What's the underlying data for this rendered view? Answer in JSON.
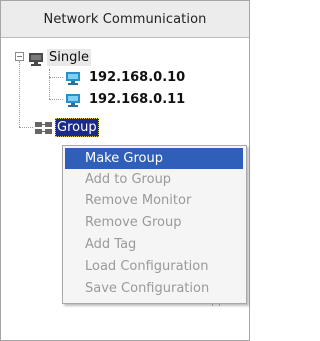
{
  "panel": {
    "header": "Network Communication"
  },
  "tree": {
    "root": {
      "label": "Single",
      "expanded": "−",
      "children": [
        {
          "label": "192.168.0.10",
          "icon": "monitor-icon"
        },
        {
          "label": "192.168.0.11",
          "icon": "monitor-icon"
        }
      ]
    },
    "group": {
      "label": "Group",
      "icon": "group-network-icon"
    }
  },
  "context_menu": {
    "items": [
      {
        "label": "Make Group",
        "enabled": true
      },
      {
        "label": "Add to Group",
        "enabled": false
      },
      {
        "label": "Remove Monitor",
        "enabled": false
      },
      {
        "label": "Remove Group",
        "enabled": false
      },
      {
        "label": "Add Tag",
        "enabled": false
      },
      {
        "label": "Load Configuration",
        "enabled": false
      },
      {
        "label": "Save Configuration",
        "enabled": false
      }
    ]
  },
  "colors": {
    "selection": "#1a2a8a",
    "menu_highlight": "#2f5fb8",
    "disabled_text": "#9a9a9a",
    "monitor_blue": "#2a8fc7"
  }
}
